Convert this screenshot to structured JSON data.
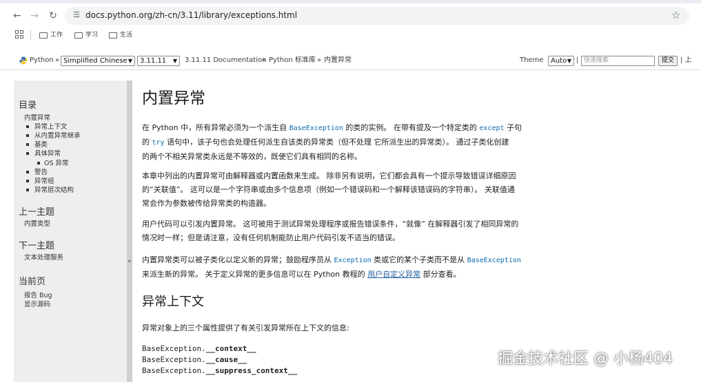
{
  "browser": {
    "url": "docs.python.org/zh-cn/3.11/library/exceptions.html",
    "bookmarks": [
      "工作",
      "学习",
      "生活"
    ]
  },
  "related": {
    "python_label": "Python",
    "sep": "»",
    "language": "Simplified Chinese",
    "version": "3.11.11",
    "crumb_docs": "3.11.11 Documentation",
    "crumb_lib": "Python 标准库",
    "crumb_page": "内置异常",
    "theme_label": "Theme",
    "theme_value": "Auto",
    "search_placeholder": "快速搜索",
    "search_button": "提交",
    "trailing": "| 上"
  },
  "sidebar": {
    "toc_heading": "目录",
    "toc": {
      "root": "内置异常",
      "items": [
        "异常上下文",
        "从内置异常继承",
        "基类",
        "具体异常"
      ],
      "sub": "OS 异常",
      "items2": [
        "警告",
        "异常组",
        "异常层次结构"
      ]
    },
    "prev_heading": "上一主题",
    "prev_link": "内置类型",
    "next_heading": "下一主题",
    "next_link": "文本处理服务",
    "this_heading": "当前页",
    "this_links": [
      "报告 Bug",
      "显示源码"
    ],
    "collapse": "«"
  },
  "main": {
    "title": "内置异常",
    "p1": {
      "a": "在 Python 中，所有异常必须为一个派生自 ",
      "code1": "BaseException",
      "b": " 的类的实例。 在带有提及一个特定类的 ",
      "code2": "except",
      "c": " 子句",
      "d": "的 ",
      "code3": "try",
      "e": " 语句中，该子句也会处理任何派生自该类的异常类（但不处理 它所派生出的异常类）。 通过子类化创建",
      "f": "的两个不相关异常类永远是不等效的，既使它们具有相同的名称。"
    },
    "p2": [
      "本章中列出的内置异常可由解释器或内置函数来生成。 除非另有说明，它们都会具有一个提示导致错误详细原因",
      "的“关联值”。 这可以是一个字符串或由多个信息项（例如一个错误码和一个解释该错误码的字符串）。 关联值通",
      "常会作为参数被传给异常类的构造器。"
    ],
    "p3": [
      "用户代码可以引发内置异常。 这可被用于测试异常处理程序或报告错误条件，“就像” 在解释器引发了相同异常的",
      "情况时一样；但是请注意，没有任何机制能防止用户代码引发不适当的错误。"
    ],
    "p4": {
      "a": "内置异常类可以被子类化以定义新的异常；鼓励程序员从 ",
      "code1": "Exception",
      "b": " 类或它的某个子类而不是从 ",
      "code2": "BaseException",
      "c": "来派生新的异常。 关于定义异常的更多信息可以在 Python 教程的 ",
      "link": "用户自定义异常",
      "d": " 部分查看。"
    },
    "h2": "异常上下文",
    "p5": "异常对象上的三个属性提供了有关引发异常所在上下文的信息:",
    "attrs": [
      {
        "prefix": "BaseException.",
        "name": "__context__"
      },
      {
        "prefix": "BaseException.",
        "name": "__cause__"
      },
      {
        "prefix": "BaseException.",
        "name": "__suppress_context__"
      }
    ]
  },
  "watermark": "掘金技术社区 @ 小杨404"
}
